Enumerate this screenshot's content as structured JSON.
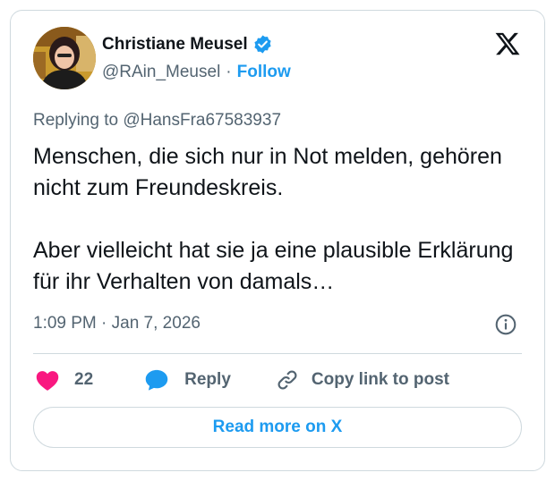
{
  "author": {
    "name": "Christiane Meusel",
    "handle": "@RAin_Meusel",
    "separator": "·",
    "follow_label": "Follow",
    "verified_icon": "verified-badge-icon"
  },
  "post": {
    "replying_to": "Replying to @HansFra67583937",
    "paragraphs": [
      "Menschen, die sich nur in Not melden, gehören nicht zum Freundeskreis.",
      "Aber vielleicht hat sie ja eine plausible Erklärung für ihr Verhalten von damals…"
    ],
    "timestamp": "1:09 PM · Jan 7, 2026"
  },
  "actions": {
    "like_count": "22",
    "reply_label": "Reply",
    "copy_link_label": "Copy link to post"
  },
  "footer": {
    "read_more_label": "Read more on X"
  },
  "colors": {
    "accent": "#1d9bf0",
    "like": "#f91880",
    "text": "#0f1419",
    "muted": "#536471",
    "border": "#cfd9de"
  }
}
